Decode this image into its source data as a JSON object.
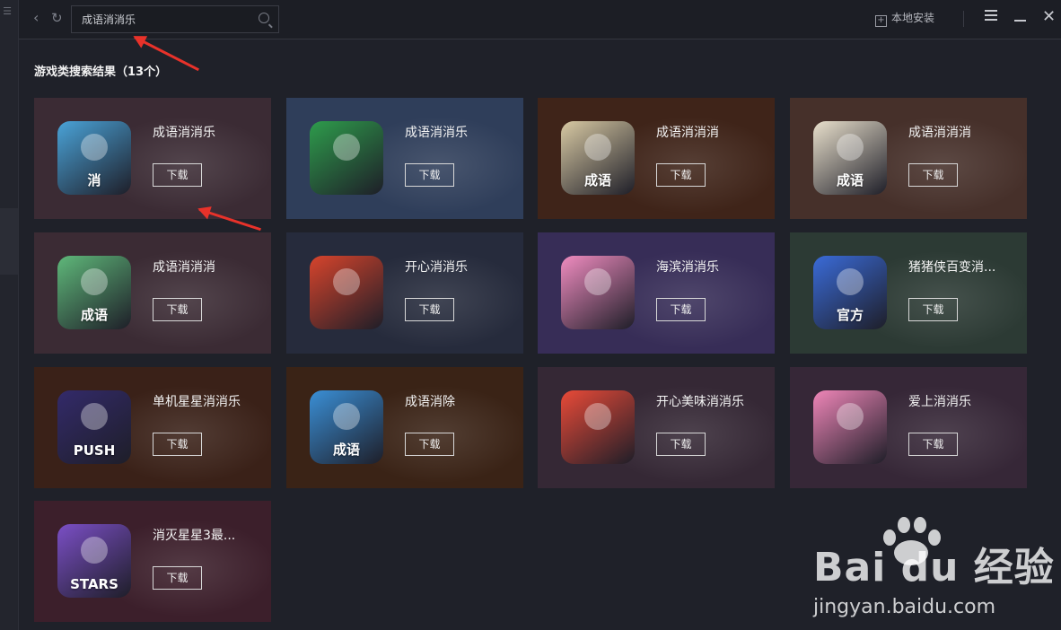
{
  "search": {
    "value": "成语消消乐",
    "placeholder": ""
  },
  "toolbar": {
    "back_icon": "back-arrow-icon",
    "refresh_icon": "refresh-icon",
    "local_install_label": "本地安装",
    "menu_icon": "menu-icon",
    "minimize_icon": "minimize-icon",
    "close_icon": "close-icon"
  },
  "results": {
    "title": "游戏类搜索结果（13个）",
    "download_label": "下载",
    "apps": [
      {
        "name": "成语消消乐",
        "icon_text": "消",
        "bg": "#3b2b34",
        "icon_bg": "#4aa3d8"
      },
      {
        "name": "成语消消乐",
        "icon_text": "",
        "bg": "#2f3e5a",
        "icon_bg": "#2e9c4c"
      },
      {
        "name": "成语消消消",
        "icon_text": "成语",
        "bg": "#3f2419",
        "icon_bg": "#d8c9a3"
      },
      {
        "name": "成语消消消",
        "icon_text": "成语",
        "bg": "#46302a",
        "icon_bg": "#e9e0cc"
      },
      {
        "name": "成语消消消",
        "icon_text": "成语",
        "bg": "#3b2b34",
        "icon_bg": "#5fb87a"
      },
      {
        "name": "开心消消乐",
        "icon_text": "",
        "bg": "#262b3c",
        "icon_bg": "#d7442c"
      },
      {
        "name": "海滨消消乐",
        "icon_text": "",
        "bg": "#372d57",
        "icon_bg": "#f08cc0"
      },
      {
        "name": "猪猪侠百变消...",
        "icon_text": "官方",
        "bg": "#2c3a34",
        "icon_bg": "#3a6bd8"
      },
      {
        "name": "单机星星消消乐",
        "icon_text": "PUSH",
        "bg": "#3a2118",
        "icon_bg": "#332a6a"
      },
      {
        "name": "成语消除",
        "icon_text": "成语",
        "bg": "#3a2316",
        "icon_bg": "#3a8fd6"
      },
      {
        "name": "开心美味消消乐",
        "icon_text": "",
        "bg": "#352835",
        "icon_bg": "#e94a38"
      },
      {
        "name": "爱上消消乐",
        "icon_text": "",
        "bg": "#362737",
        "icon_bg": "#ef86b8"
      },
      {
        "name": "消灭星星3最...",
        "icon_text": "STARS",
        "bg": "#3c1f2b",
        "icon_bg": "#7b4fc6"
      }
    ]
  },
  "watermark": {
    "logo": "Bai du 经验",
    "url": "jingyan.baidu.com"
  }
}
